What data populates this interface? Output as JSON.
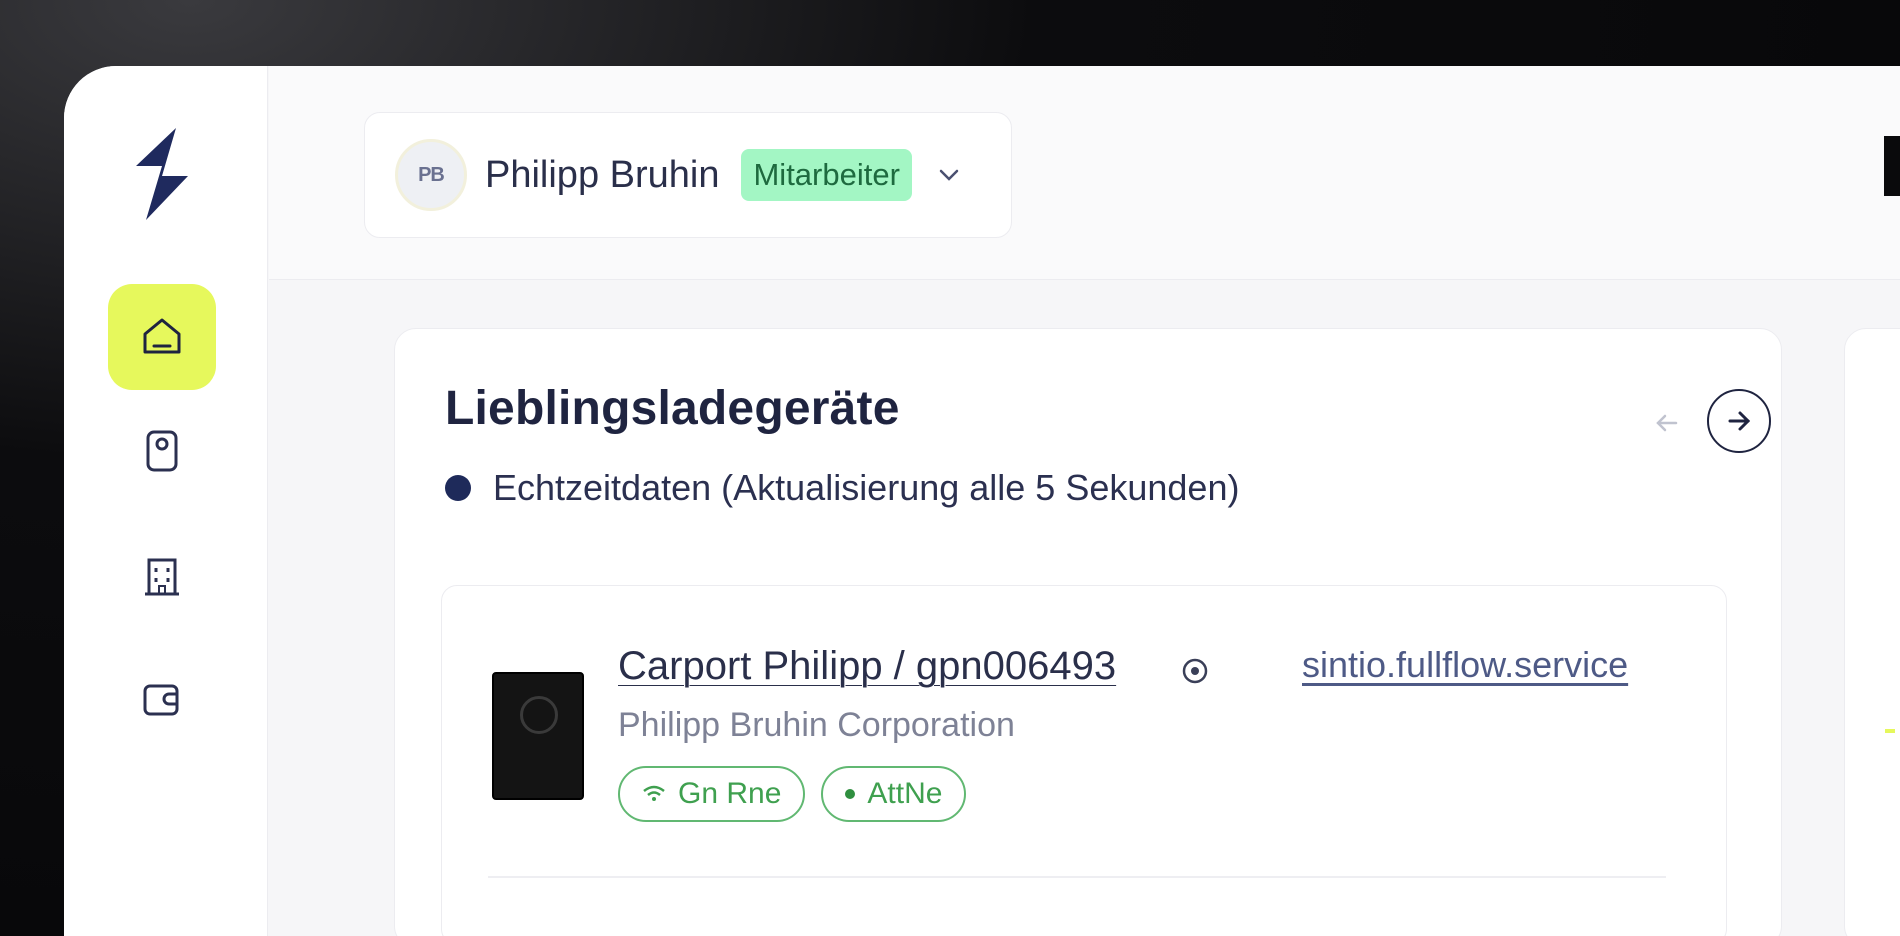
{
  "user": {
    "initials": "PB",
    "name": "Philipp Bruhin",
    "role": "Mitarbeiter"
  },
  "favorites": {
    "title": "Lieblingsladegeräte",
    "realtime_note": "Echtzeitdaten (Aktualisierung alle 5 Sekunden)"
  },
  "device": {
    "name": "Carport Philipp / gpn006493",
    "company": "Philipp Bruhin Corporation",
    "service": "sintio.fullflow.service",
    "chip_connection": "Gn Rne",
    "chip_status": "AttNe"
  },
  "colors": {
    "accent": "#e6f85c",
    "role_badge": "#a3f6c4",
    "status_green": "#3fa04f",
    "primary_dark": "#1e2a5a"
  },
  "icons": {
    "logo": "brand-logo-icon",
    "nav": [
      "home-icon",
      "charger-icon",
      "building-icon",
      "wallet-icon"
    ]
  }
}
